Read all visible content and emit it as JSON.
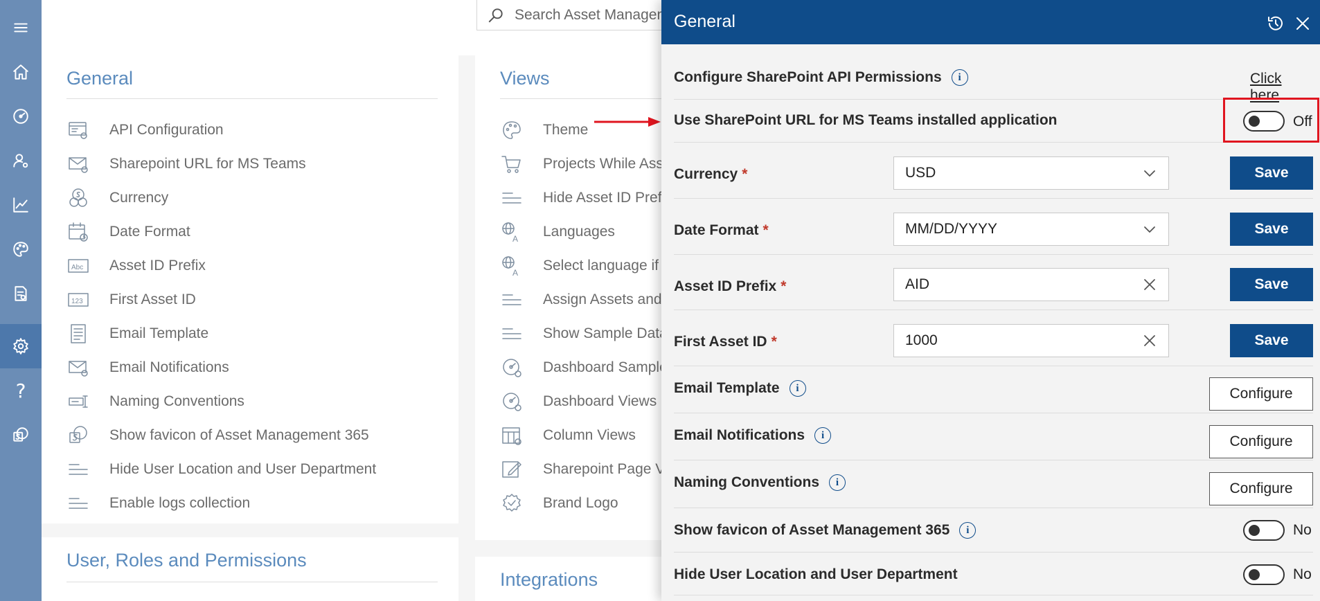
{
  "search": {
    "placeholder": "Search Asset Management"
  },
  "rail": {
    "items": [
      {
        "icon": "menu-icon"
      },
      {
        "icon": "home-icon"
      },
      {
        "icon": "dashboard-icon"
      },
      {
        "icon": "user-settings-icon"
      },
      {
        "icon": "chart-icon"
      },
      {
        "icon": "palette-icon"
      },
      {
        "icon": "report-icon"
      },
      {
        "icon": "gear-icon",
        "active": true
      },
      {
        "icon": "help-icon",
        "glyph": "?"
      },
      {
        "icon": "sharepoint-icon"
      }
    ]
  },
  "general_card": {
    "title": "General",
    "items": [
      {
        "label": "API Configuration",
        "icon": "api-config-icon"
      },
      {
        "label": "Sharepoint URL for MS Teams",
        "icon": "mail-gear-icon"
      },
      {
        "label": "Currency",
        "icon": "currency-icon"
      },
      {
        "label": "Date Format",
        "icon": "calendar-icon"
      },
      {
        "label": "Asset ID Prefix",
        "icon": "abc-icon"
      },
      {
        "label": "First Asset ID",
        "icon": "number-icon"
      },
      {
        "label": "Email Template",
        "icon": "document-icon"
      },
      {
        "label": "Email Notifications",
        "icon": "mail-gear-icon"
      },
      {
        "label": "Naming Conventions",
        "icon": "naming-icon"
      },
      {
        "label": "Show favicon of Asset Management 365",
        "icon": "sharepoint-icon"
      },
      {
        "label": "Hide User Location and User Department",
        "icon": "lines-icon"
      },
      {
        "label": "Enable logs collection",
        "icon": "lines-icon"
      }
    ]
  },
  "views_card": {
    "title": "Views",
    "items": [
      {
        "label": "Theme",
        "icon": "palette-icon"
      },
      {
        "label": "Projects While Assi",
        "icon": "cart-icon"
      },
      {
        "label": "Hide Asset ID Prefix",
        "icon": "lines-icon"
      },
      {
        "label": "Languages",
        "icon": "language-icon"
      },
      {
        "label": "Select language if b",
        "icon": "language-icon"
      },
      {
        "label": "Assign Assets and F",
        "icon": "lines-icon"
      },
      {
        "label": "Show Sample Data",
        "icon": "lines-icon"
      },
      {
        "label": "Dashboard Sample",
        "icon": "dashboard-icon"
      },
      {
        "label": "Dashboard Views",
        "icon": "dashboard-icon"
      },
      {
        "label": "Column Views",
        "icon": "column-icon"
      },
      {
        "label": "Sharepoint Page Vi",
        "icon": "edit-icon"
      },
      {
        "label": "Brand Logo",
        "icon": "badge-icon"
      }
    ]
  },
  "urp_card": {
    "title": "User, Roles and Permissions"
  },
  "integrations_card": {
    "title": "Integrations"
  },
  "panel": {
    "title": "General",
    "rows": {
      "api_permissions": {
        "label": "Configure SharePoint API Permissions",
        "link": "Click here"
      },
      "teams_url": {
        "label": "Use SharePoint URL for MS Teams installed application",
        "state": "Off"
      },
      "currency": {
        "label": "Currency",
        "required": "*",
        "value": "USD",
        "save": "Save"
      },
      "date_format": {
        "label": "Date Format",
        "required": "*",
        "value": "MM/DD/YYYY",
        "save": "Save"
      },
      "asset_prefix": {
        "label": "Asset ID Prefix",
        "required": "*",
        "value": "AID",
        "save": "Save"
      },
      "first_asset_id": {
        "label": "First Asset ID",
        "required": "*",
        "value": "1000",
        "save": "Save"
      },
      "email_template": {
        "label": "Email Template",
        "button": "Configure"
      },
      "email_notifications": {
        "label": "Email Notifications",
        "button": "Configure"
      },
      "naming_conventions": {
        "label": "Naming Conventions",
        "button": "Configure"
      },
      "show_favicon": {
        "label": "Show favicon of Asset Management 365",
        "state": "No"
      },
      "hide_location": {
        "label": "Hide User Location and User Department",
        "state": "No"
      }
    }
  },
  "colors": {
    "rail": "#6b8db6",
    "panel_header": "#0f4c8a",
    "accent": "#5b8bbd",
    "highlight": "#e0151f"
  }
}
